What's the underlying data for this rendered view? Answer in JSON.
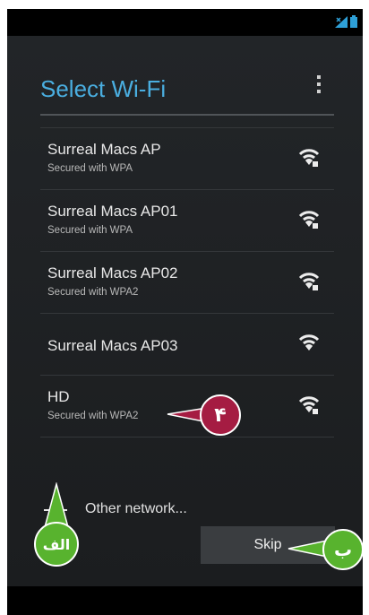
{
  "header": {
    "title": "Select Wi-Fi"
  },
  "networks": [
    {
      "name": "Surreal Macs AP",
      "security": "Secured with WPA",
      "secured": true
    },
    {
      "name": "Surreal Macs AP01",
      "security": "Secured with WPA",
      "secured": true
    },
    {
      "name": "Surreal Macs AP02",
      "security": "Secured with WPA2",
      "secured": true
    },
    {
      "name": "Surreal Macs AP03",
      "security": "",
      "secured": false
    },
    {
      "name": "HD",
      "security": "Secured with WPA2",
      "secured": true
    }
  ],
  "add_network": {
    "label": "Other network..."
  },
  "footer": {
    "skip_label": "Skip"
  },
  "annotations": {
    "alef": "الف",
    "be": "ب",
    "four": "۴"
  },
  "colors": {
    "accent": "#4aaee0",
    "annotation_red": "#a51c42",
    "annotation_green": "#58b32e"
  }
}
